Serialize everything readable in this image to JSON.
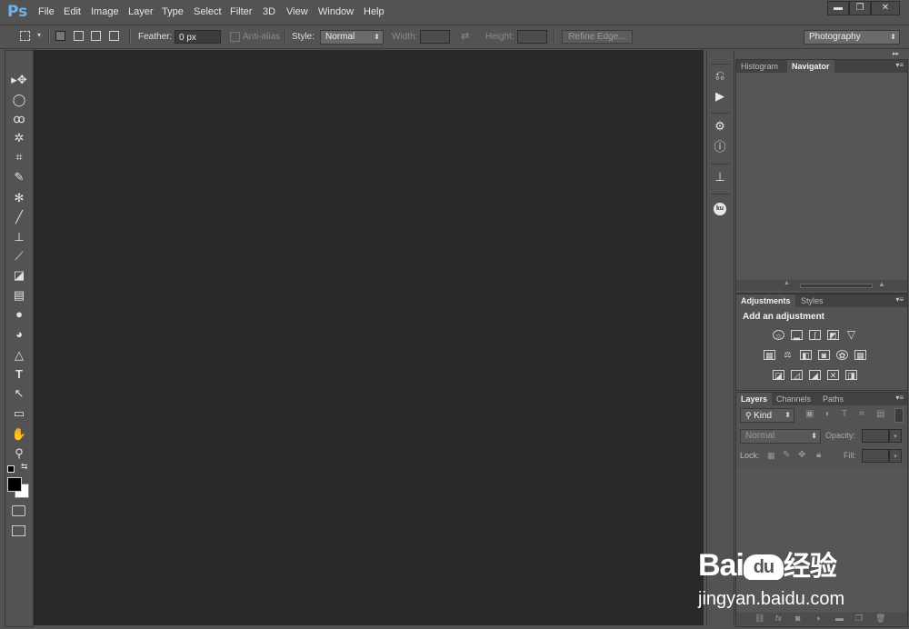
{
  "app": {
    "logo": "Ps"
  },
  "menu": [
    "File",
    "Edit",
    "Image",
    "Layer",
    "Type",
    "Select",
    "Filter",
    "3D",
    "View",
    "Window",
    "Help"
  ],
  "window_controls": {
    "minimize": "▬",
    "maximize": "❐",
    "close": "✕"
  },
  "options_bar": {
    "feather_label": "Feather:",
    "feather_value": "0 px",
    "antialias_label": "Anti-alias",
    "style_label": "Style:",
    "style_value": "Normal",
    "width_label": "Width:",
    "height_label": "Height:",
    "refine_edge_label": "Refine Edge...",
    "workspace_value": "Photography"
  },
  "tools": [
    "move-tool",
    "marquee-tool",
    "lasso-tool",
    "magic-wand-tool",
    "crop-tool",
    "eyedropper-tool",
    "healing-brush-tool",
    "brush-tool",
    "clone-stamp-tool",
    "history-brush-tool",
    "eraser-tool",
    "gradient-tool",
    "blur-tool",
    "dodge-tool",
    "pen-tool",
    "type-tool",
    "path-selection-tool",
    "rectangle-tool",
    "hand-tool",
    "zoom-tool"
  ],
  "tool_glyphs": [
    "▸✥",
    "◯",
    "ꝏ",
    "✲",
    "⌗",
    "✎",
    "✻",
    "╱",
    "⊥",
    "⟋",
    "◪",
    "▤",
    "●",
    "◕",
    "△",
    "T",
    "↖",
    "▭",
    "✋",
    "⚲"
  ],
  "navigator_panel": {
    "tabs": [
      "Histogram",
      "Navigator"
    ],
    "active": "Navigator"
  },
  "adjustments_panel": {
    "tabs": [
      "Adjustments",
      "Styles"
    ],
    "active": "Adjustments",
    "heading": "Add an adjustment",
    "icons_row1": [
      "brightness-contrast-icon",
      "levels-icon",
      "curves-icon",
      "exposure-icon",
      "vibrance-icon"
    ],
    "icons_row2": [
      "hue-saturation-icon",
      "color-balance-icon",
      "black-white-icon",
      "photo-filter-icon",
      "channel-mixer-icon",
      "color-lookup-icon"
    ],
    "icons_row3": [
      "invert-icon",
      "posterize-icon",
      "threshold-icon",
      "selective-color-icon",
      "gradient-map-icon"
    ]
  },
  "layers_panel": {
    "tabs": [
      "Layers",
      "Channels",
      "Paths"
    ],
    "active": "Layers",
    "filter_label": "Kind",
    "blend_mode": "Normal",
    "opacity_label": "Opacity:",
    "lock_label": "Lock:",
    "fill_label": "Fill:"
  },
  "watermark": {
    "brand": "Bai",
    "brand_suffix": "经验",
    "url": "jingyan.baidu.com"
  }
}
